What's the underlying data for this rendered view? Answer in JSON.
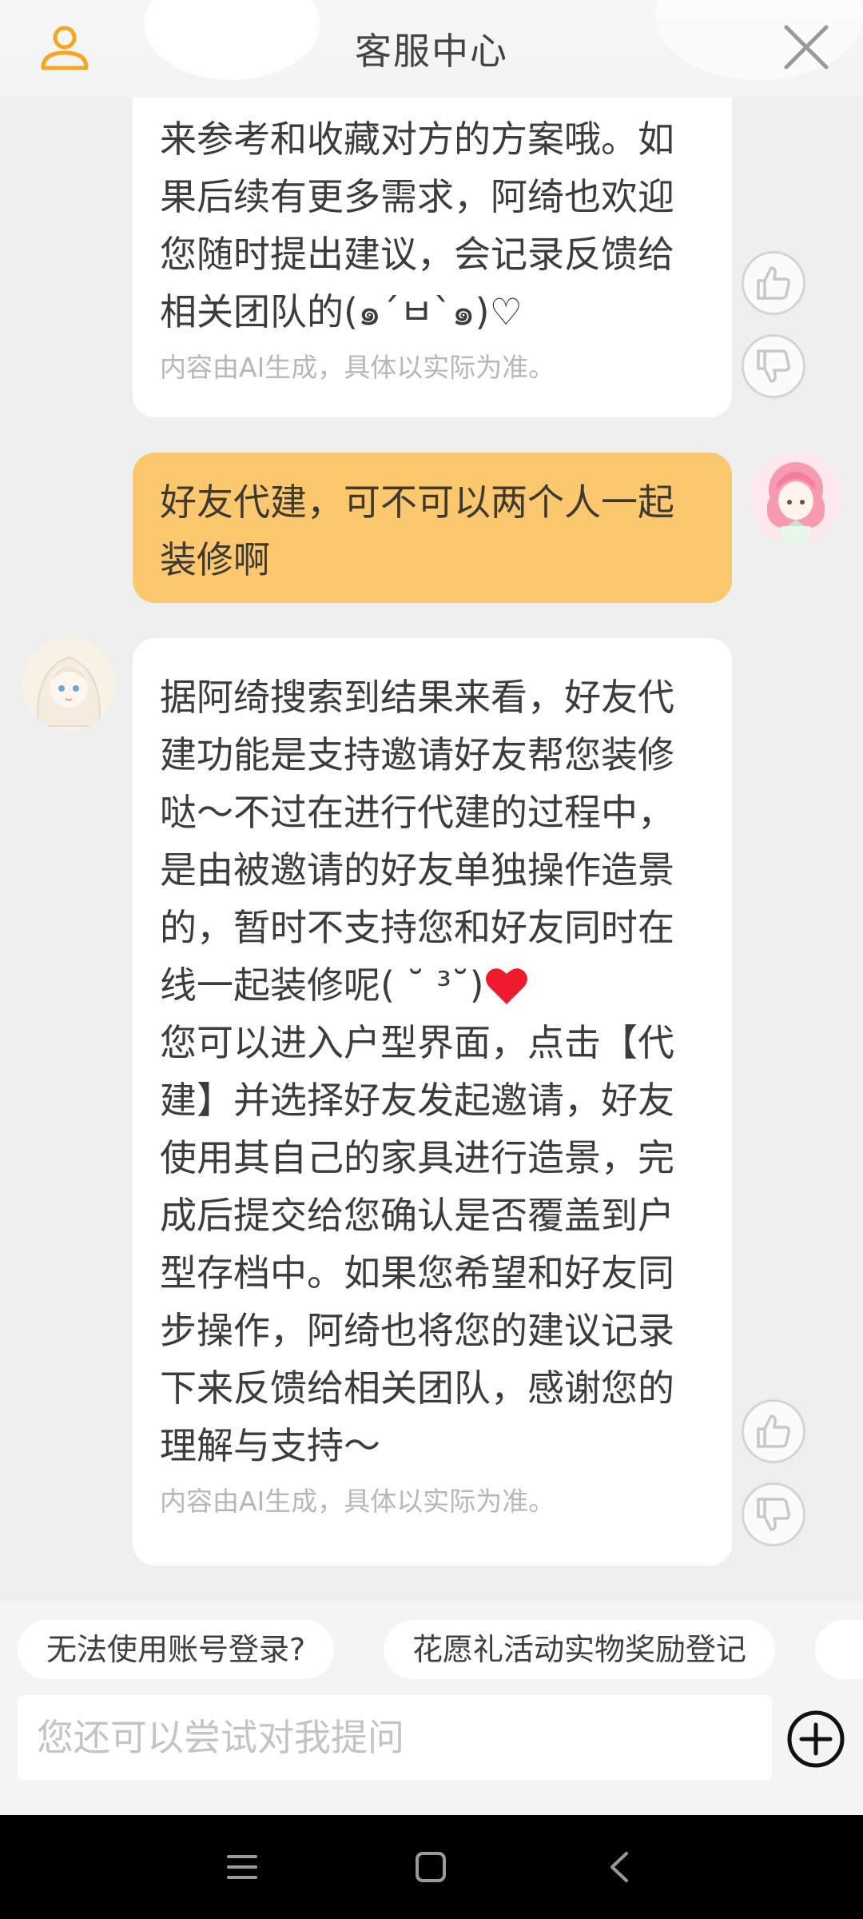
{
  "header": {
    "title": "客服中心",
    "user_icon": "user-icon",
    "close_icon": "close-icon",
    "accent_color": "#f5a623"
  },
  "messages": [
    {
      "role": "assistant",
      "lines": [
        "来参考和收藏对方的方案哦。如",
        "果后续有更多需求，阿绮也欢迎",
        "您随时提出建议，会记录反馈给",
        "相关团队的(๑´ㅂ`๑)♡"
      ],
      "note": "内容由AI生成，具体以实际为准。"
    },
    {
      "role": "user",
      "lines": [
        "好友代建，可不可以两个人一起",
        "装修啊"
      ]
    },
    {
      "role": "assistant",
      "lines": [
        "据阿绮搜索到结果来看，好友代",
        "建功能是支持邀请好友帮您装修",
        "哒～不过在进行代建的过程中，",
        "是由被邀请的好友单独操作造景",
        "的，暂时不支持您和好友同时在",
        "线一起装修呢( ˘ ³˘)",
        "您可以进入户型界面，点击【代",
        "建】并选择好友发起邀请，好友",
        "使用其自己的家具进行造景，完",
        "成后提交给您确认是否覆盖到户",
        "型存档中。如果您希望和好友同",
        "步操作，阿绮也将您的建议记录",
        "下来反馈给相关团队，感谢您的",
        "理解与支持～"
      ],
      "note": "内容由AI生成，具体以实际为准。"
    }
  ],
  "quick_replies": [
    "无法使用账号登录?",
    "花愿礼活动实物奖励登记"
  ],
  "input": {
    "placeholder": "您还可以尝试对我提问"
  },
  "icons": {
    "like": "thumbs-up-icon",
    "dislike": "thumbs-down-icon",
    "heart": "heart-icon",
    "plus": "plus-circle-icon",
    "menu": "menu-icon",
    "home": "home-icon",
    "back": "back-icon"
  }
}
